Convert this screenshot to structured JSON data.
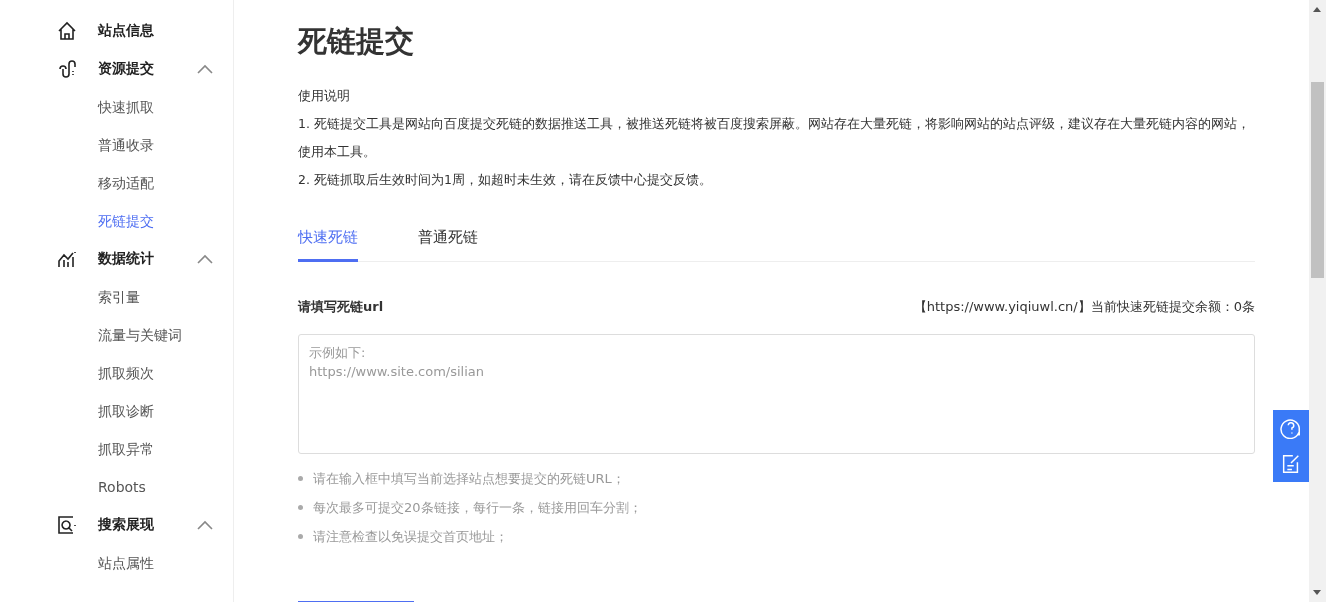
{
  "sidebar": {
    "groups": [
      {
        "label": "站点信息"
      },
      {
        "label": "资源提交",
        "expanded": true,
        "children": [
          {
            "label": "快速抓取",
            "selected": false
          },
          {
            "label": "普通收录",
            "selected": false
          },
          {
            "label": "移动适配",
            "selected": false
          },
          {
            "label": "死链提交",
            "selected": true
          }
        ]
      },
      {
        "label": "数据统计",
        "expanded": true,
        "children": [
          {
            "label": "索引量",
            "selected": false
          },
          {
            "label": "流量与关键词",
            "selected": false
          },
          {
            "label": "抓取频次",
            "selected": false
          },
          {
            "label": "抓取诊断",
            "selected": false
          },
          {
            "label": "抓取异常",
            "selected": false
          },
          {
            "label": "Robots",
            "selected": false
          }
        ]
      },
      {
        "label": "搜索展现",
        "expanded": true,
        "children": [
          {
            "label": "站点属性",
            "selected": false
          }
        ]
      }
    ]
  },
  "page": {
    "title": "死链提交",
    "instructions": [
      "使用说明",
      "1. 死链提交工具是网站向百度提交死链的数据推送工具，被推送死链将被百度搜索屏蔽。网站存在大量死链，将影响网站的站点评级，建议存在大量死链内容的网站，使用本工具。",
      "2. 死链抓取后生效时间为1周，如超时未生效，请在反馈中心提交反馈。"
    ],
    "tabs": [
      {
        "label": "快速死链",
        "selected": true
      },
      {
        "label": "普通死链",
        "selected": false
      }
    ],
    "form": {
      "label": "请填写死链url",
      "quota": "【https://www.yiqiuwl.cn/】当前快速死链提交余额：0条",
      "placeholder": "示例如下:\nhttps://www.site.com/silian",
      "tips": [
        "请在输入框中填写当前选择站点想要提交的死链URL；",
        "每次最多可提交20条链接，每行一条，链接用回车分割；",
        "请注意检查以免误提交首页地址；"
      ]
    }
  }
}
